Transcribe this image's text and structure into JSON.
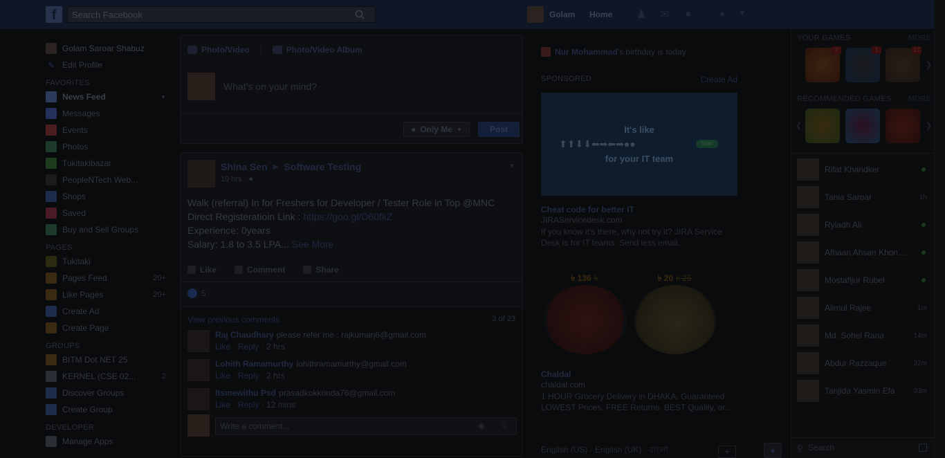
{
  "topbar": {
    "search_placeholder": "Search Facebook",
    "user_name": "Golam",
    "home_label": "Home"
  },
  "left_nav": {
    "profile_name": "Golam Saroar Shabuz",
    "edit_profile": "Edit Profile",
    "favorites_head": "FAVORITES",
    "favorites": [
      {
        "label": "News Feed",
        "icon": "newsfeed-icon",
        "color": "#2c3a5c"
      },
      {
        "label": "Messages",
        "icon": "messages-icon",
        "color": "#24305a"
      },
      {
        "label": "Events",
        "icon": "events-icon",
        "color": "#4a1e1e"
      },
      {
        "label": "Photos",
        "icon": "photos-icon",
        "color": "#1d3a2a"
      },
      {
        "label": "Tukitakibazar",
        "icon": "tukitaki-icon",
        "color": "#1e3b1e"
      },
      {
        "label": "PeopleNTech Web...",
        "icon": "graduation-cap-icon",
        "color": "#1c1c1c"
      },
      {
        "label": "Shops",
        "icon": "shops-icon",
        "color": "#1c2c4a"
      },
      {
        "label": "Saved",
        "icon": "saved-icon",
        "color": "#4a1a26"
      },
      {
        "label": "Buy and Sell Groups",
        "icon": "buy-sell-icon",
        "color": "#1e3a2c"
      }
    ],
    "pages_head": "PAGES",
    "pages": [
      {
        "label": "Tukitaki",
        "icon": "page-tukitaki-icon",
        "color": "#2c2a10",
        "count": ""
      },
      {
        "label": "Pages Feed",
        "icon": "pages-feed-icon",
        "color": "#3a2a12",
        "count": "20+"
      },
      {
        "label": "Like Pages",
        "icon": "like-pages-icon",
        "color": "#3a2a12",
        "count": "20+"
      },
      {
        "label": "Create Ad",
        "icon": "create-ad-icon",
        "color": "#1c2c4a",
        "count": ""
      },
      {
        "label": "Create Page",
        "icon": "create-page-icon",
        "color": "#3a2a12",
        "count": ""
      }
    ],
    "groups_head": "GROUPS",
    "groups": [
      {
        "label": "BITM Dot NET 25",
        "icon": "group-bitm-icon",
        "color": "#3a2a12",
        "count": ""
      },
      {
        "label": "KERNEL (CSE 02...",
        "icon": "group-kernel-icon",
        "color": "#2a2e35",
        "count": "2"
      },
      {
        "label": "Discover Groups",
        "icon": "discover-groups-icon",
        "color": "#1c2c4a",
        "count": ""
      },
      {
        "label": "Create Group",
        "icon": "create-group-icon",
        "color": "#1c2c4a",
        "count": ""
      }
    ],
    "developer_head": "DEVELOPER",
    "developer": [
      {
        "label": "Manage Apps",
        "icon": "manage-apps-icon",
        "color": "#2a2e35"
      }
    ]
  },
  "composer": {
    "tab_photo": "Photo/Video",
    "tab_album": "Photo/Video Album",
    "placeholder": "What's on your mind?",
    "privacy": "Only Me",
    "post": "Post"
  },
  "story": {
    "author": "Shina Sen",
    "group": "Software Testing",
    "time": "10 hrs",
    "line1": "Walk (referral) In for Freshers for Developer / Tester Role in Top @MNC",
    "line2_prefix": "Direct Registeratioin Link : ",
    "line2_link": "https://goo.gl/D60fkZ",
    "line3": "Experience: 0years",
    "line4": "Salary: 1.8 to 3.5 LPA... ",
    "see_more": "See More",
    "like": "Like",
    "comment": "Comment",
    "share": "Share",
    "like_count": "5",
    "view_previous": "View previous comments",
    "comment_count": "3 of 23",
    "comments": [
      {
        "name": "Raj Chaudhary",
        "text": "please refer me : rajkumarj6@gmail.com",
        "like": "Like",
        "reply": "Reply",
        "time": "2 hrs"
      },
      {
        "name": "Lohith Ramamurthy",
        "text": "lohithramamurthy@gmail.com",
        "like": "Like",
        "reply": "Reply",
        "time": "2 hrs"
      },
      {
        "name": "Itsmewithu Psd",
        "text": "prasadkokkonda76@gmail.com",
        "like": "Like",
        "reply": "Reply",
        "time": "12 mins"
      }
    ],
    "write_placeholder": "Write a comment..."
  },
  "right": {
    "birthday_name": "Nur Mohammad",
    "birthday_text": "'s birthday is today",
    "sponsored": "SPONSORED",
    "create_ad": "Create Ad",
    "ad1_line1": "It's like",
    "ad1_line2": "for your IT team",
    "ad1_start": "Start",
    "ad1_title": "Cheat code for better IT",
    "ad1_domain": "JIRAServicedesk.com",
    "ad1_desc": "If you know it's there, why not try it? JIRA Service Desk is for IT teams. Send less email.",
    "prod1_price": "৳ 136",
    "prod1_old": "৳",
    "prod2_price": "৳ 20",
    "prod2_old": "৳ 25",
    "ad2_title": "Chaldal",
    "ad2_domain": "chaldal.com",
    "ad2_desc": "1 HOUR Grocery Delivery in DHAKA. Guaranteed LOWEST Prices. FREE Returns. BEST Quality, or...",
    "languages": "English (US) · English (UK) · বাংলা",
    "lang_plus": "+"
  },
  "chat": {
    "your_games": "YOUR GAMES",
    "recommended_games": "RECOMMENDED GAMES",
    "more": "MORE",
    "your_game_badges": [
      "2",
      "1",
      "27"
    ],
    "friends": [
      {
        "name": "Rifat Khandker",
        "status": "online"
      },
      {
        "name": "Tania Saroar",
        "status": "1h"
      },
      {
        "name": "Ryiadh Ali",
        "status": "online"
      },
      {
        "name": "Afhaan Ahsan Khond...",
        "status": "online"
      },
      {
        "name": "Mostafijur Rubel",
        "status": "online"
      },
      {
        "name": "Alimul Rajee",
        "status": "1m"
      },
      {
        "name": "Md. Sohel Rana",
        "status": "14m"
      },
      {
        "name": "Abdur Razzaque",
        "status": "32m"
      },
      {
        "name": "Tanjida Yasmin Efa",
        "status": "33m"
      }
    ],
    "search_placeholder": "Search"
  }
}
